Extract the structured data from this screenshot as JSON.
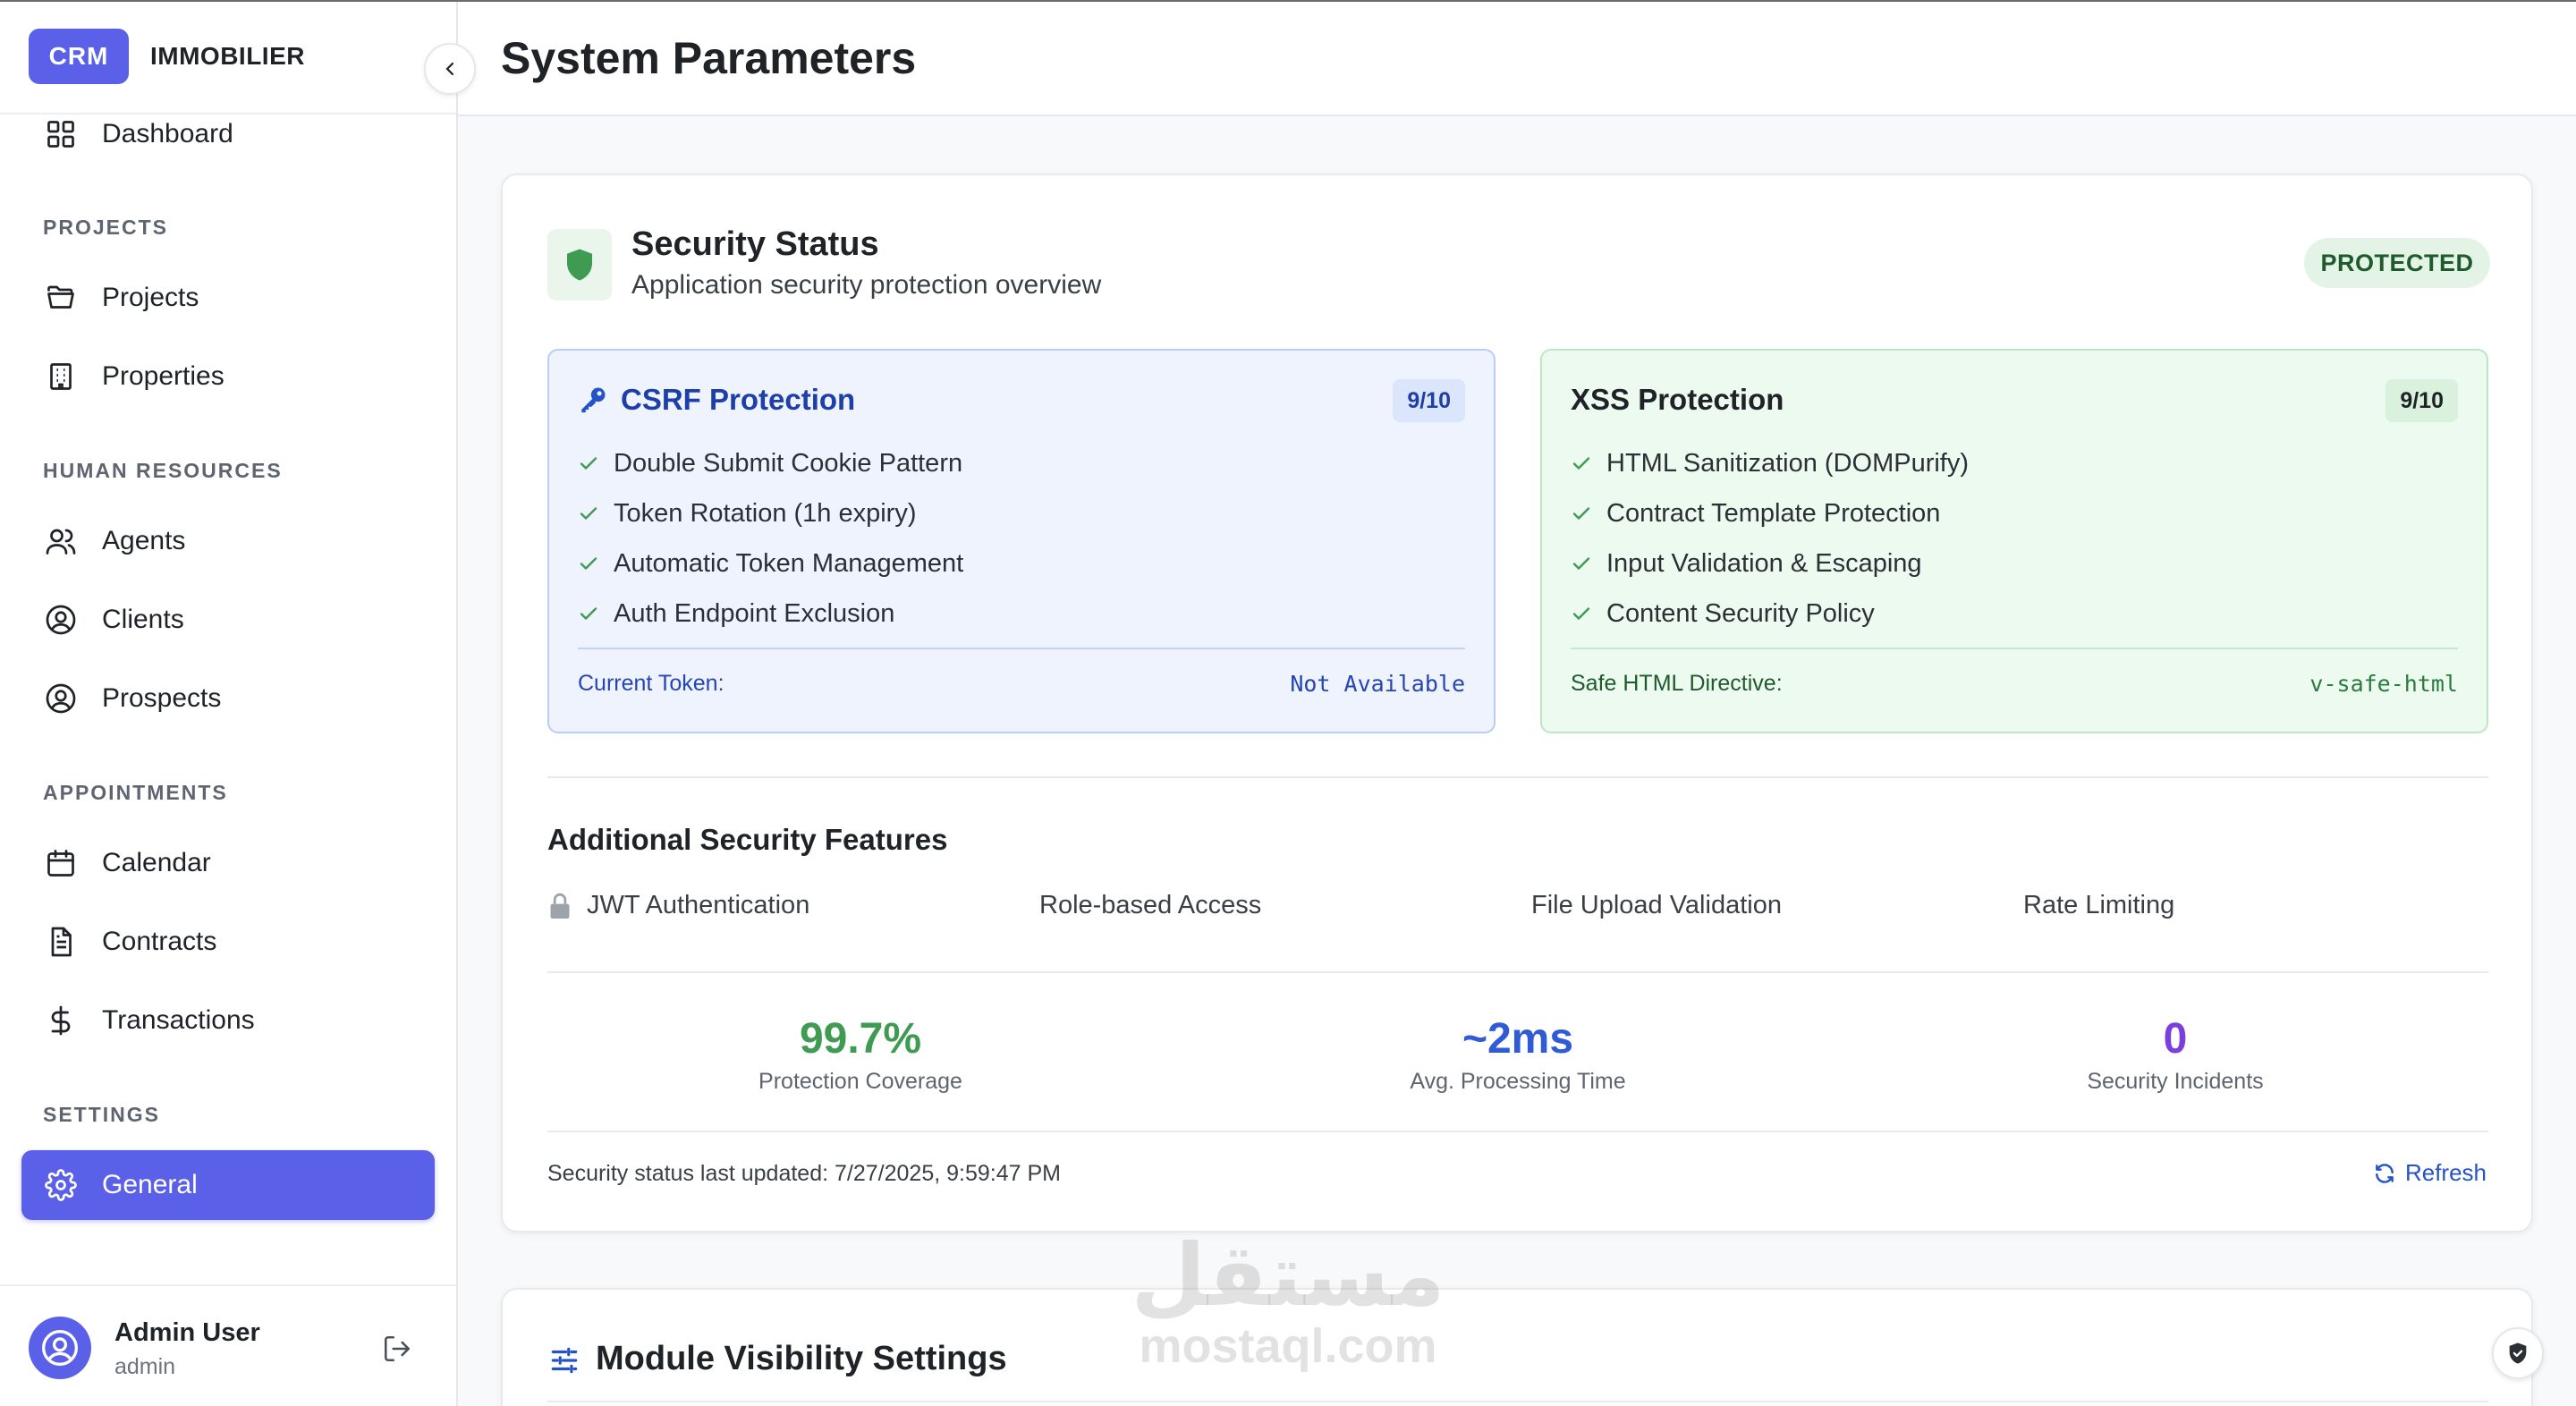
{
  "sidebar": {
    "brand_badge": "CRM",
    "brand_name": "IMMOBILIER",
    "dashboard": "Dashboard",
    "sections": {
      "projects": "PROJECTS",
      "hr": "HUMAN RESOURCES",
      "appointments": "APPOINTMENTS",
      "settings": "SETTINGS"
    },
    "items": {
      "projects": "Projects",
      "properties": "Properties",
      "agents": "Agents",
      "clients": "Clients",
      "prospects": "Prospects",
      "calendar": "Calendar",
      "contracts": "Contracts",
      "transactions": "Transactions",
      "general": "General"
    },
    "user": {
      "name": "Admin User",
      "role": "admin"
    }
  },
  "header": {
    "title": "System Parameters"
  },
  "security": {
    "title": "Security Status",
    "subtitle": "Application security protection overview",
    "status": "PROTECTED",
    "csrf": {
      "title": "CSRF Protection",
      "score": "9/10",
      "features": [
        "Double Submit Cookie Pattern",
        "Token Rotation (1h expiry)",
        "Automatic Token Management",
        "Auth Endpoint Exclusion"
      ],
      "footer_label": "Current Token:",
      "footer_value": "Not Available"
    },
    "xss": {
      "title": "XSS Protection",
      "score": "9/10",
      "features": [
        "HTML Sanitization (DOMPurify)",
        "Contract Template Protection",
        "Input Validation & Escaping",
        "Content Security Policy"
      ],
      "footer_label": "Safe HTML Directive:",
      "footer_value": "v-safe-html"
    },
    "additional_title": "Additional Security Features",
    "additional": [
      "JWT Authentication",
      "Role-based Access",
      "File Upload Validation",
      "Rate Limiting"
    ],
    "stats": [
      {
        "value": "99.7%",
        "label": "Protection Coverage",
        "color": "#3f9a52"
      },
      {
        "value": "~2ms",
        "label": "Avg. Processing Time",
        "color": "#2f5bd6"
      },
      {
        "value": "0",
        "label": "Security Incidents",
        "color": "#7b3fe0"
      }
    ],
    "updated": "Security status last updated: 7/27/2025, 9:59:47 PM",
    "refresh": "Refresh"
  },
  "modules": {
    "title": "Module Visibility Settings"
  },
  "watermark": {
    "arabic": "مستقل",
    "latin": "mostaql.com"
  },
  "colors": {
    "accent": "#5b60e8",
    "success": "#3f9a52",
    "info": "#2f5bd6",
    "purple": "#7b3fe0"
  },
  "icons": {
    "dashboard": "grid-icon",
    "projects": "folder-icon",
    "properties": "building-icon",
    "agents": "users-icon",
    "clients": "user-circle-icon",
    "prospects": "user-circle-icon",
    "calendar": "calendar-icon",
    "contracts": "document-icon",
    "transactions": "dollar-icon",
    "general": "gear-icon"
  }
}
